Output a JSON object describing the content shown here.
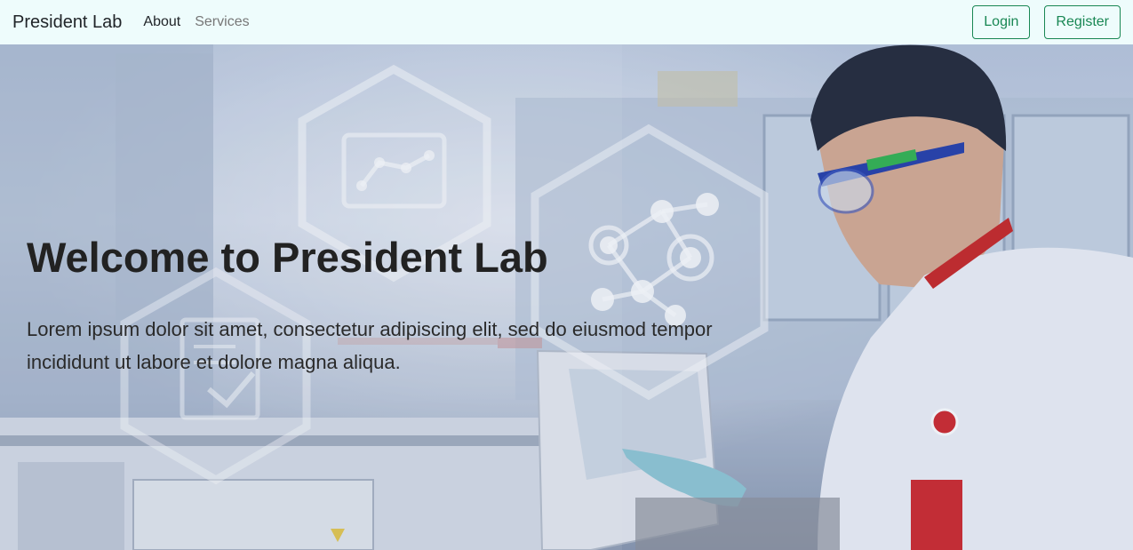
{
  "navbar": {
    "brand": "President Lab",
    "links": [
      {
        "label": "About",
        "active": true
      },
      {
        "label": "Services",
        "active": false
      }
    ],
    "login_label": "Login",
    "register_label": "Register",
    "background": "#eefcfc",
    "accent": "#198754"
  },
  "hero": {
    "title": "Welcome to President Lab",
    "text": "Lorem ipsum dolor sit amet, consectetur adipiscing elit, sed do eiusmod tempor incididunt ut labore et dolore magna aliqua."
  }
}
